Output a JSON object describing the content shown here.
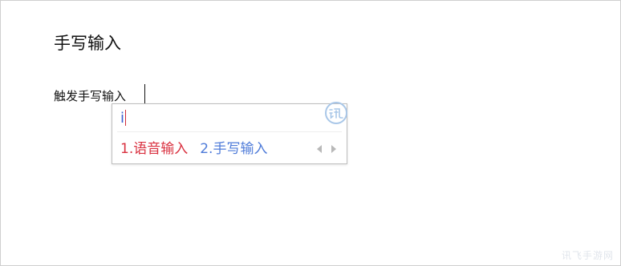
{
  "page": {
    "title": "手写输入"
  },
  "editor": {
    "text": "触发手写输入"
  },
  "ime": {
    "composition": "i",
    "logo_icon": "iflytek-logo-icon",
    "candidates": [
      {
        "label": "1.语音输入",
        "color": "#d9303f"
      },
      {
        "label": "2.手写输入",
        "color": "#4e7bd9"
      }
    ],
    "pager": {
      "prev_icon": "triangle-left-icon",
      "next_icon": "triangle-right-icon"
    }
  },
  "watermark": {
    "text": "讯飞手游网"
  },
  "colors": {
    "composition": "#3b5fd1",
    "caret": "#d02b3a",
    "panel_border": "#bdbdbd",
    "logo": "#a9c7e8"
  }
}
